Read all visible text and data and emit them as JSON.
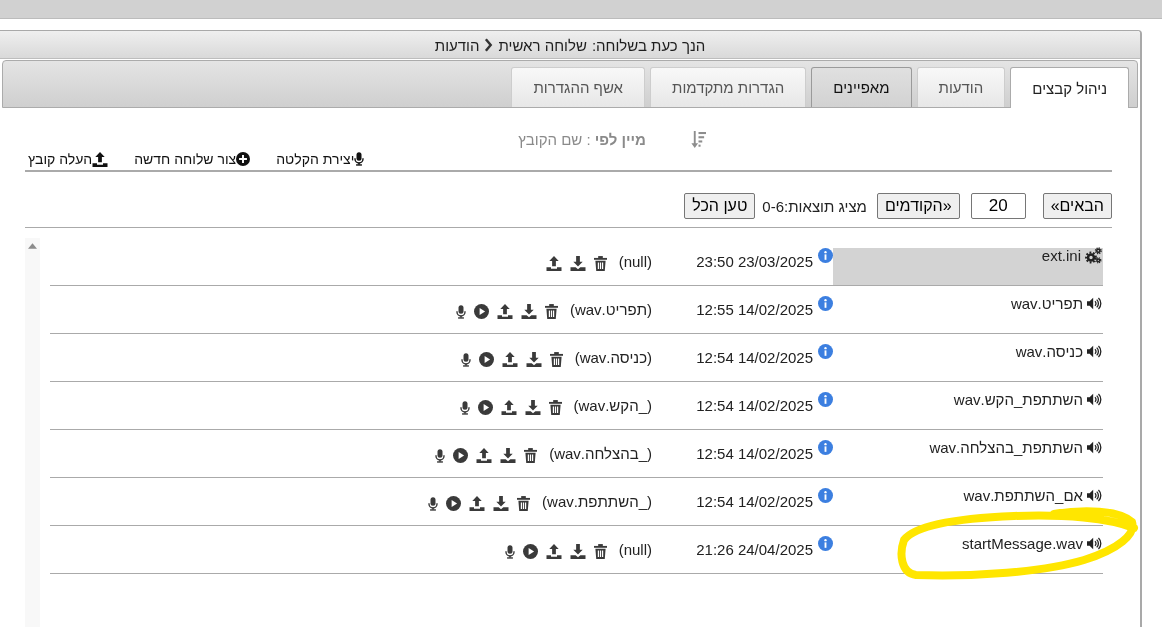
{
  "breadcrumb": {
    "label": "הנך כעת בשלוחה:",
    "path": [
      "שלוחה ראשית",
      "הודעות"
    ]
  },
  "tabs": [
    {
      "label": "ניהול קבצים",
      "selected": true,
      "hovered": false
    },
    {
      "label": "הודעות",
      "selected": false,
      "hovered": false
    },
    {
      "label": "מאפיינים",
      "selected": false,
      "hovered": true
    },
    {
      "label": "הגדרות מתקדמות",
      "selected": false,
      "hovered": false
    },
    {
      "label": "אשף ההגדרות",
      "selected": false,
      "hovered": false
    }
  ],
  "toolbar": {
    "sort": "**מיין לפי** : שם הקובץ",
    "actions": [
      {
        "kind": "record",
        "label": "יצירת הקלטה"
      },
      {
        "kind": "new-extension",
        "label": "צור שלוחה חדשה"
      },
      {
        "kind": "upload",
        "label": "העלה קובץ"
      }
    ]
  },
  "pager": {
    "next": "«הבאים",
    "page_size": "20",
    "previous": "הקודמים»",
    "showing": "מציג תוצאות:0-6",
    "load_all": "טען הכל"
  },
  "files": [
    {
      "kind": "ini",
      "name": "ext.ini",
      "modified": "23/03/2025 23:50",
      "description": "(null)",
      "selected": true,
      "circled": false
    },
    {
      "kind": "wav",
      "name": "תפריט.wav",
      "modified": "14/02/2025 12:55",
      "description": "(תפריט.wav)",
      "selected": false,
      "circled": false
    },
    {
      "kind": "wav",
      "name": "כניסה.wav",
      "modified": "14/02/2025 12:54",
      "description": "(כניסה.wav)",
      "selected": false,
      "circled": false
    },
    {
      "kind": "wav",
      "name": "השתתפת_הקש.wav",
      "modified": "14/02/2025 12:54",
      "description": "(_הקש.wav)",
      "selected": false,
      "circled": false
    },
    {
      "kind": "wav",
      "name": "השתתפת_בהצלחה.wav",
      "modified": "14/02/2025 12:54",
      "description": "(_בהצלחה.wav)",
      "selected": false,
      "circled": false
    },
    {
      "kind": "wav",
      "name": "אם_השתתפת.wav",
      "modified": "14/02/2025 12:54",
      "description": "(_השתתפת.wav)",
      "selected": false,
      "circled": false
    },
    {
      "kind": "wav",
      "name": "startMessage.wav",
      "modified": "24/04/2025 21:26",
      "description": "(null)",
      "selected": false,
      "circled": true
    }
  ]
}
